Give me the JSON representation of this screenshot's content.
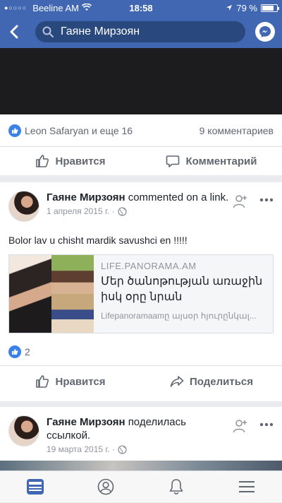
{
  "status": {
    "carrier": "Beeline AM",
    "time": "18:58",
    "battery": "79 %",
    "battery_level": 0.79
  },
  "search": {
    "value": "Гаяне Мирзоян"
  },
  "post1": {
    "likers": "Leon Safaryan и еще 16",
    "comments": "9 комментариев",
    "like_label": "Нравится",
    "comment_label": "Комментарий"
  },
  "post2": {
    "author": "Гаяне Мирзоян",
    "action": "commented on a link.",
    "date": "1 апреля 2015 г. ·",
    "text": "Bolor lav u chisht mardik savushci en !!!!!",
    "link": {
      "domain": "LIFE.PANORAMA.AM",
      "title": "Մեր ծանոթության առաջին իսկ օրը նրան ամուսնության առ...",
      "desc": "Lifepanoramaamը այսօր հյուրընկալ..."
    },
    "like_count": "2",
    "like_label": "Нравится",
    "share_label": "Поделиться"
  },
  "post3": {
    "author": "Гаяне Мирзоян",
    "action": "поделилась ссылкой.",
    "date": "19 марта 2015 г. ·"
  },
  "colors": {
    "brand": "#4267b2",
    "like": "#3b82e8"
  }
}
